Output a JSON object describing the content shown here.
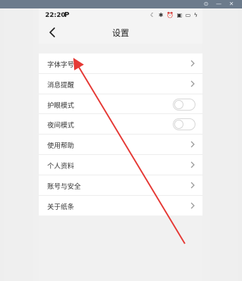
{
  "status_bar": {
    "time": "22:20",
    "carrier_glyph": "P",
    "icons": [
      "moon-icon",
      "bluetooth-icon",
      "alarm-icon",
      "sim-icon",
      "battery-icon",
      "charging-icon"
    ]
  },
  "window_controls": [
    "⊙",
    "—",
    "✕"
  ],
  "nav": {
    "title": "设置",
    "back_icon": "chevron-left-icon"
  },
  "settings": {
    "items": [
      {
        "label": "字体字号",
        "control": "chevron"
      },
      {
        "label": "消息提醒",
        "control": "chevron"
      },
      {
        "label": "护眼模式",
        "control": "toggle",
        "on": false
      },
      {
        "label": "夜间模式",
        "control": "toggle",
        "on": false
      },
      {
        "label": "使用帮助",
        "control": "chevron"
      },
      {
        "label": "个人资料",
        "control": "chevron"
      },
      {
        "label": "账号与安全",
        "control": "chevron"
      },
      {
        "label": "关于纸条",
        "control": "chevron"
      }
    ]
  },
  "annotation": {
    "color": "#e53935",
    "points_to": "字体字号"
  }
}
